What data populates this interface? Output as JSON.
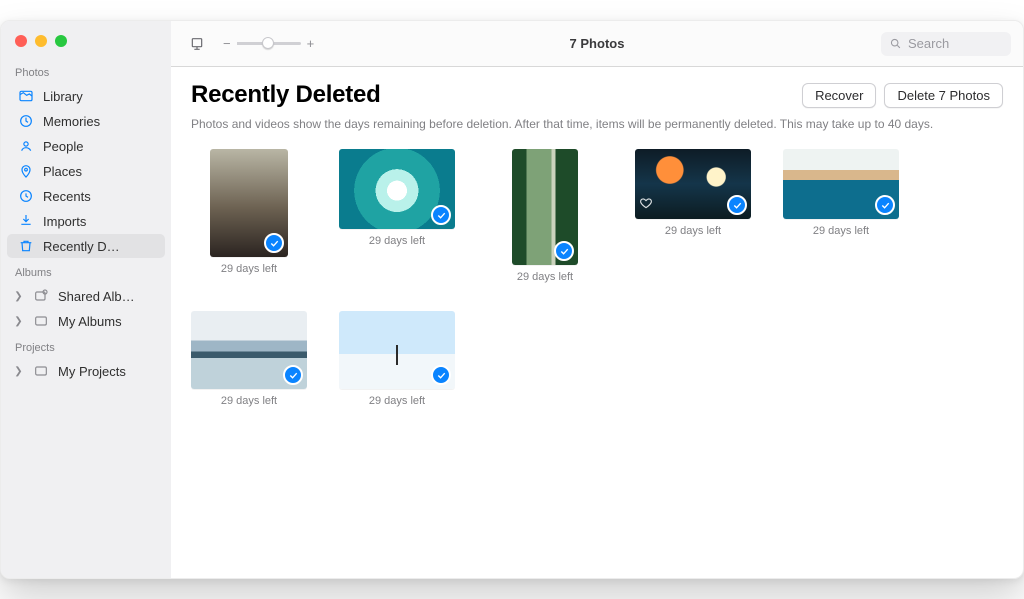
{
  "toolbar": {
    "title": "7 Photos",
    "search_placeholder": "Search"
  },
  "sidebar": {
    "sections": [
      {
        "header": "Photos",
        "items": [
          {
            "icon": "library",
            "label": "Library"
          },
          {
            "icon": "memories",
            "label": "Memories"
          },
          {
            "icon": "people",
            "label": "People"
          },
          {
            "icon": "places",
            "label": "Places"
          },
          {
            "icon": "recents",
            "label": "Recents"
          },
          {
            "icon": "imports",
            "label": "Imports"
          },
          {
            "icon": "trash",
            "label": "Recently D…",
            "selected": true
          }
        ]
      },
      {
        "header": "Albums",
        "items": [
          {
            "disclosure": true,
            "icon": "shared",
            "label": "Shared Alb…"
          },
          {
            "disclosure": true,
            "icon": "album",
            "label": "My Albums"
          }
        ]
      },
      {
        "header": "Projects",
        "items": [
          {
            "disclosure": true,
            "icon": "album",
            "label": "My Projects"
          }
        ]
      }
    ]
  },
  "main": {
    "heading": "Recently Deleted",
    "recover_label": "Recover",
    "delete_label": "Delete 7 Photos",
    "note": "Photos and videos show the days remaining before deletion. After that time, items will be permanently deleted. This may take up to 40 days.",
    "photos": [
      {
        "caption": "29 days left",
        "p": "p0",
        "selected": true
      },
      {
        "caption": "29 days left",
        "p": "p1",
        "selected": true
      },
      {
        "caption": "29 days left",
        "p": "p2",
        "selected": true
      },
      {
        "caption": "29 days left",
        "p": "p3",
        "selected": true,
        "favorite": true
      },
      {
        "caption": "29 days left",
        "p": "p4",
        "selected": true
      },
      {
        "caption": "29 days left",
        "p": "p5",
        "selected": true
      },
      {
        "caption": "29 days left",
        "p": "p6",
        "selected": true
      }
    ]
  }
}
